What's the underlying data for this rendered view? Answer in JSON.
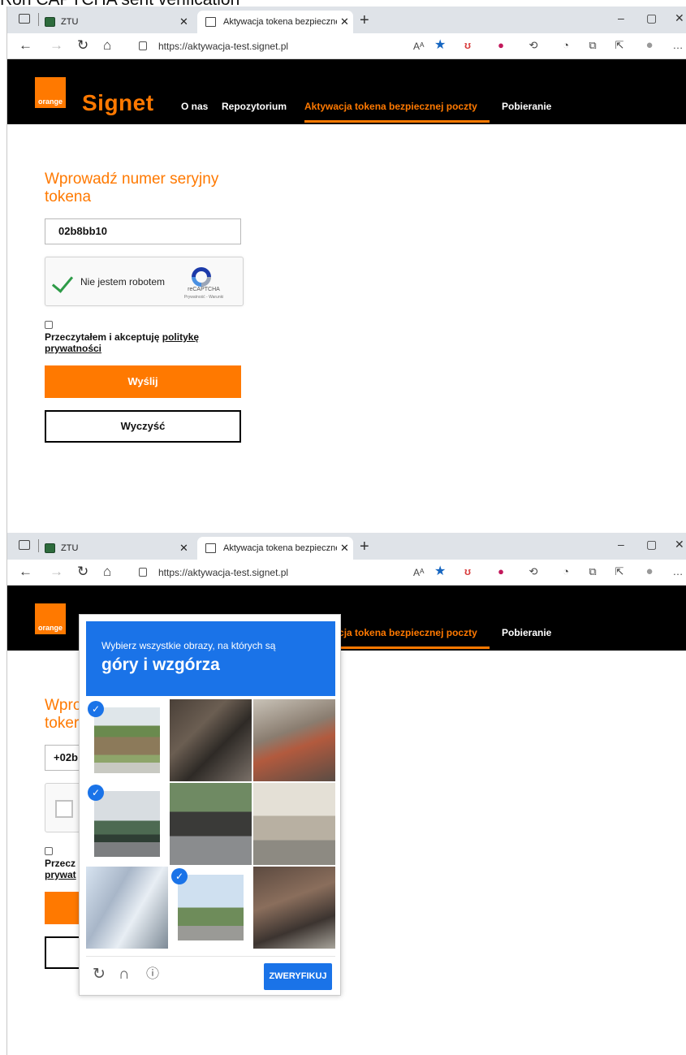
{
  "caption": "Ron CAPTCHA sent verification",
  "browser": {
    "tabs": [
      {
        "label": "ZTU"
      },
      {
        "label": "Aktywacja tokena bezpiecznej p"
      }
    ],
    "url": "https://aktywacja-test.signet.pl",
    "read_aloud": "Aᴬ"
  },
  "site": {
    "logo_text": "orange",
    "brand": "Signet",
    "menu": [
      {
        "label": "O nas"
      },
      {
        "label": "Repozytorium"
      },
      {
        "label": "Aktywacja tokena bezpiecznej poczty"
      },
      {
        "label": "Pobieranie"
      }
    ],
    "accent_color": "#ff7900"
  },
  "form": {
    "title": "Wprowadź numer seryjny tokena",
    "serial_value": "02b8bb10",
    "captcha_label": "Nie jestem robotem",
    "captcha_brand": "reCAPTCHA",
    "captcha_links": "Prywatność - Warunki",
    "accept_text": "Przeczytałem i akceptuję",
    "accept_link_1": "politykę",
    "accept_link_2": "prywatności",
    "send_label": "Wyślij",
    "clear_label": "Wyczyść"
  },
  "partial": {
    "title_1": "Wpro",
    "title_2": "toker",
    "serial": "+02b",
    "accept_1": "Przecz",
    "accept_2": "prywat"
  },
  "challenge": {
    "instruction": "Wybierz wszystkie obrazy, na których są",
    "target": "góry i wzgórza",
    "verify_label": "ZWERYFIKUJ",
    "tiles": [
      {
        "subject": "mountain-cliff",
        "selected": true
      },
      {
        "subject": "bicycle",
        "selected": false
      },
      {
        "subject": "street-bicycle",
        "selected": false
      },
      {
        "subject": "mountain-bridge",
        "selected": true
      },
      {
        "subject": "man-on-bicycle",
        "selected": false
      },
      {
        "subject": "hallway-bicycles",
        "selected": false
      },
      {
        "subject": "blurred-cyclist",
        "selected": false
      },
      {
        "subject": "traffic-light-hill",
        "selected": true
      },
      {
        "subject": "doorway-bicycle",
        "selected": false
      }
    ],
    "primary_color": "#1a73e8"
  }
}
